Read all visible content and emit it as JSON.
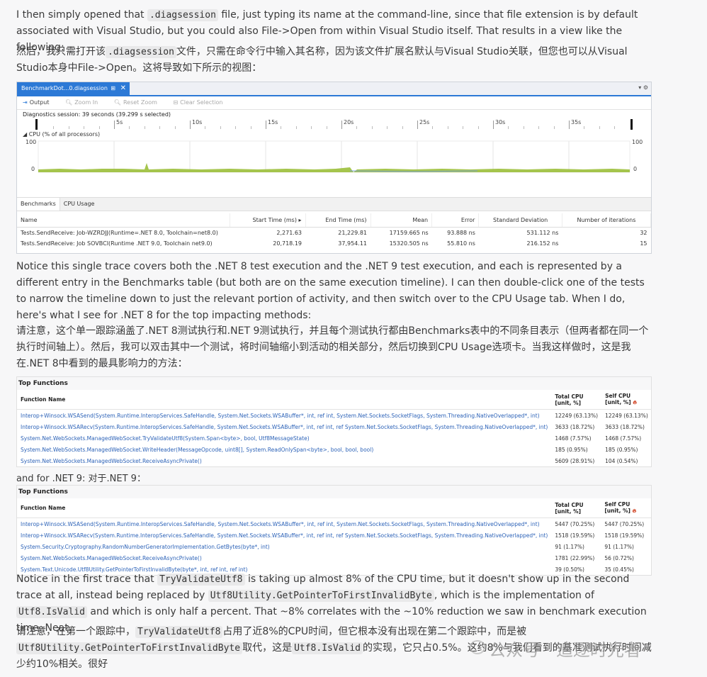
{
  "para1": {
    "t1": "I then simply opened that ",
    "c1": ".diagsession",
    "t2": " file, just typing its name at the command-line, since that file extension is by default associated with Visual Studio, but you could also File->Open from within Visual Studio itself. That results in a view like the following:"
  },
  "para1_cn": {
    "t1": "然后，我只需打开该",
    "c1": ".diagsession",
    "t2": "文件，只需在命令行中输入其名称，因为该文件扩展名默认与Visual Studio关联，但您也可以从Visual Studio本身中File->Open。这将导致如下所示的视图："
  },
  "vs": {
    "tab_title": "BenchmarkDot...0.diagsession",
    "tab_pin": "⊞",
    "tab_close": "✕",
    "menu": "▾ ⚙",
    "toolbar": {
      "output": "Output",
      "zoom_in": "Zoom In",
      "reset_zoom": "Reset Zoom",
      "clear_selection": "Clear Selection"
    },
    "session": "Diagnostics session: 39 seconds (39.299 s selected)",
    "ruler_labels": [
      "5s",
      "10s",
      "15s",
      "20s",
      "25s",
      "30s",
      "35s"
    ],
    "cpu_title": "◢ CPU (% of all processors)",
    "y_max": "100",
    "y_min": "0",
    "tabs": [
      "Benchmarks",
      "CPU Usage"
    ],
    "columns": [
      "Name",
      "Start Time (ms) ▸",
      "End Time (ms)",
      "Mean",
      "Error",
      "Standard Deviation",
      "Number of iterations"
    ],
    "rows": [
      [
        "Tests.SendReceive: Job-WZRDJJ(Runtime=.NET 8.0, Toolchain=net8.0)",
        "2,271.63",
        "21,229.81",
        "17159.665 ns",
        "93.888 ns",
        "531.112 ns",
        "32"
      ],
      [
        "Tests.SendReceive: Job SOVBCI(Runtime  .NET 9.0, Toolchain  net9.0)",
        "20,718.19",
        "37,954.11",
        "15320.505 ns",
        "55.810 ns",
        "216.152 ns",
        "15"
      ]
    ]
  },
  "para2": "Notice this single trace covers both the .NET 8 test execution and the .NET 9 test execution, and each is represented by a different entry in the Benchmarks table (but both are on the same execution timeline). I can then double-click one of the tests to narrow the timeline down to just the relevant portion of activity, and then switch over to the CPU Usage tab. When I do, here's what I see for .NET 8 for the top impacting methods:",
  "para2_cn": "请注意，这个单一跟踪涵盖了.NET 8测试执行和.NET 9测试执行，并且每个测试执行都由Benchmarks表中的不同条目表示（但两者都在同一个执行时间轴上）。然后，我可以双击其中一个测试，将时间轴缩小到活动的相关部分，然后切换到CPU Usage选项卡。当我这样做时，这是我在.NET 8中看到的最具影响力的方法：",
  "top8": {
    "title": "Top Functions",
    "headers": [
      "Function Name",
      "Total CPU [unit, %]",
      "Self CPU [unit, %]"
    ],
    "rows": [
      [
        "Interop+Winsock.WSASend(System.Runtime.InteropServices.SafeHandle, System.Net.Sockets.WSABuffer*, int, ref int, System.Net.Sockets.SocketFlags, System.Threading.NativeOverlapped*, int)",
        "12249 (63.13%)",
        "12249 (63.13%)"
      ],
      [
        "Interop+Winsock.WSARecv(System.Runtime.InteropServices.SafeHandle, System.Net.Sockets.WSABuffer*, int, ref int, ref System.Net.Sockets.SocketFlags, System.Threading.NativeOverlapped*, int)",
        "3633 (18.72%)",
        "3633 (18.72%)"
      ],
      [
        "System.Net.WebSockets.ManagedWebSocket.TryValidateUtf8(System.Span<byte>, bool, Utf8MessageState)",
        "1468 (7.57%)",
        "1468 (7.57%)"
      ],
      [
        "System.Net.WebSockets.ManagedWebSocket.WriteHeader(MessageOpcode, uint8[], System.ReadOnlySpan<byte>, bool, bool, bool)",
        "185 (0.95%)",
        "185 (0.95%)"
      ],
      [
        "System.Net.WebSockets.ManagedWebSocket.ReceiveAsyncPrivate()",
        "5609 (28.91%)",
        "104 (0.54%)"
      ]
    ]
  },
  "para3": "and for .NET 9:  对于.NET 9：",
  "top9": {
    "title": "Top Functions",
    "headers": [
      "Function Name",
      "Total CPU [unit, %]",
      "Self CPU [unit, %]"
    ],
    "rows": [
      [
        "Interop+Winsock.WSASend(System.Runtime.InteropServices.SafeHandle, System.Net.Sockets.WSABuffer*, int, ref int, System.Net.Sockets.SocketFlags, System.Threading.NativeOverlapped*, int)",
        "5447 (70.25%)",
        "5447 (70.25%)"
      ],
      [
        "Interop+Winsock.WSARecv(System.Runtime.InteropServices.SafeHandle, System.Net.Sockets.WSABuffer*, int, ref int, ref System.Net.Sockets.SocketFlags, System.Threading.NativeOverlapped*, int)",
        "1518 (19.59%)",
        "1518 (19.59%)"
      ],
      [
        "System.Security.Cryptography.RandomNumberGeneratorImplementation.GetBytes(byte*, int)",
        "91 (1.17%)",
        "91 (1.17%)"
      ],
      [
        "System.Net.WebSockets.ManagedWebSocket.ReceiveAsyncPrivate()",
        "1781 (22.99%)",
        "56 (0.72%)"
      ],
      [
        "System.Text.Unicode.Utf8Utility.GetPointerToFirstInvalidByte(byte*, int, ref int, ref int)",
        "39 (0.50%)",
        "35 (0.45%)"
      ]
    ]
  },
  "para4": {
    "t1": "Notice in the first trace that ",
    "c1": "TryValidateUtf8",
    "t2": " is taking up almost 8% of the CPU time, but it doesn't show up in the second trace at all, instead being replaced by ",
    "c2": "Utf8Utility.GetPointerToFirstInvalidByte",
    "t3": ", which is the implementation of ",
    "c3": "Utf8.IsValid",
    "t4": " and which is only half a percent. That ~8% correlates with the ~10% reduction we saw in benchmark execution time. Neat."
  },
  "para4_cn": {
    "t1": "请注意，在第一个跟踪中，",
    "c1": "TryValidateUtf8",
    "t2": "占用了近8%的CPU时间，但它根本没有出现在第二个跟踪中，而是被",
    "c2": "Utf8Utility.GetPointerToFirstInvalidByte",
    "t3": "取代，这是",
    "c3": "Utf8.IsValid",
    "t4": "的实现，它只占0.5%。这约8%与我们看到的基准测试执行时间减少约10%相关。很好"
  },
  "watermark": "公众号 · 追逐时光者",
  "colors": {
    "accent": "#2c79d6",
    "cpu_fill": "#9bbf3a",
    "link": "#2d63b8"
  }
}
